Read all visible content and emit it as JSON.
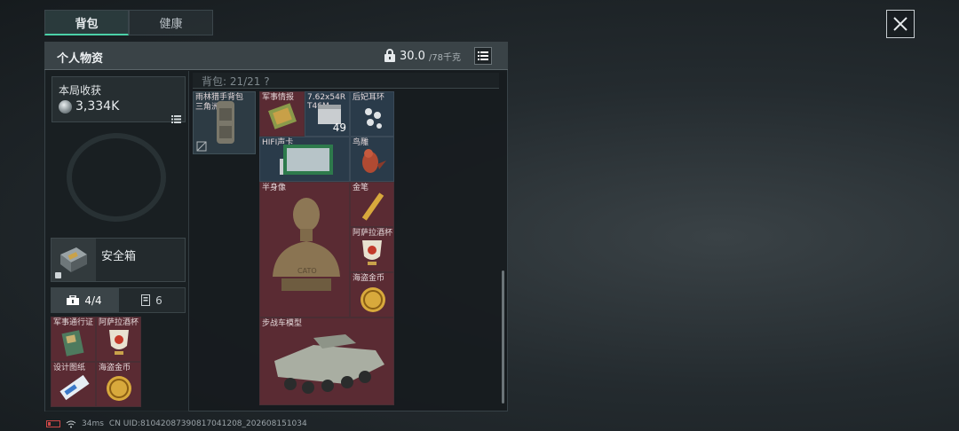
{
  "tabs": [
    {
      "label": "背包"
    },
    {
      "label": "健康"
    }
  ],
  "panel": {
    "title": "个人物资",
    "weight_current": "30.0",
    "weight_max": "/78千克"
  },
  "harvest": {
    "label": "本局收获",
    "value": "3,334K"
  },
  "safe": {
    "label": "安全箱"
  },
  "subtabs": [
    {
      "label": "4/4"
    },
    {
      "label": "6"
    }
  ],
  "safe_items": [
    {
      "label": "军事通行证"
    },
    {
      "label": "阿萨拉酒杯"
    },
    {
      "label": "设计图纸"
    },
    {
      "label": "海盗金币"
    }
  ],
  "bag": {
    "header": "背包: 21/21  ?"
  },
  "backpack_item": {
    "label": "雨林猎手背包",
    "sub": "三角洲"
  },
  "grid_items": [
    {
      "label": "军事情报"
    },
    {
      "label": "7.62x54R",
      "sub": "T46M",
      "qty": "49"
    },
    {
      "label": "后妃耳环"
    },
    {
      "label": "HIFI声卡"
    },
    {
      "label": "鸟雕"
    },
    {
      "label": "半身像",
      "plate": "CATO"
    },
    {
      "label": "金笔"
    },
    {
      "label": "阿萨拉酒杯"
    },
    {
      "label": "海盗金币"
    },
    {
      "label": "步战车模型"
    }
  ],
  "footer": {
    "ping": "34ms",
    "uid": "CN UID:8104208739081704120​8_202608151034"
  },
  "colors": {
    "accent": "#4bd1a8",
    "cell_red": "#5a2b33",
    "cell_blue": "#2a3b4a"
  }
}
